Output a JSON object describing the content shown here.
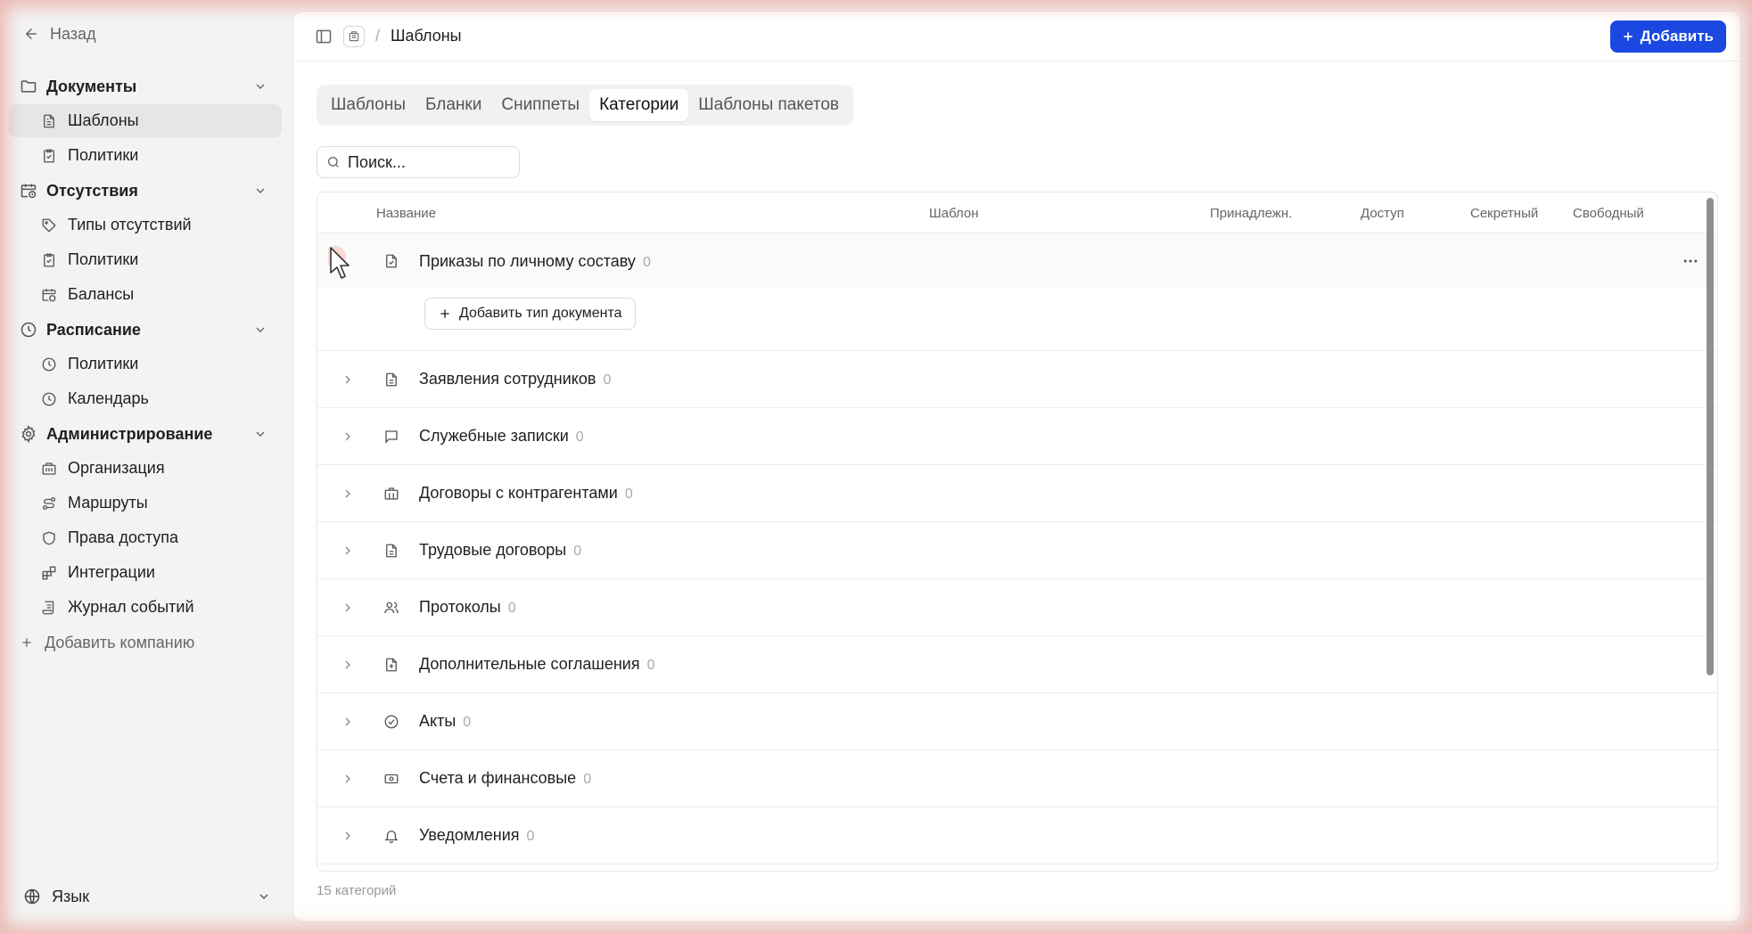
{
  "sidebar": {
    "back_label": "Назад",
    "groups": [
      {
        "label": "Документы",
        "icon": "folder-icon"
      },
      {
        "label": "Отсутствия",
        "icon": "calendar-clock-icon"
      },
      {
        "label": "Расписание",
        "icon": "clock-icon"
      },
      {
        "label": "Администрирование",
        "icon": "gear-icon"
      }
    ],
    "items": [
      {
        "label": "Шаблоны",
        "icon": "file-text-icon"
      },
      {
        "label": "Политики",
        "icon": "clipboard-check-icon"
      },
      {
        "label": "Типы отсутствий",
        "icon": "tag-icon"
      },
      {
        "label": "Политики",
        "icon": "clipboard-check-icon"
      },
      {
        "label": "Балансы",
        "icon": "calendar-clock-icon"
      },
      {
        "label": "Политики",
        "icon": "clock-icon"
      },
      {
        "label": "Календарь",
        "icon": "clock-icon"
      },
      {
        "label": "Организация",
        "icon": "building-icon"
      },
      {
        "label": "Маршруты",
        "icon": "route-icon"
      },
      {
        "label": "Права доступа",
        "icon": "shield-icon"
      },
      {
        "label": "Интеграции",
        "icon": "blocks-icon"
      },
      {
        "label": "Журнал событий",
        "icon": "scroll-icon"
      }
    ],
    "add_company_label": "Добавить компанию",
    "language_label": "Язык"
  },
  "header": {
    "breadcrumb": "Шаблоны",
    "separator": "/",
    "add_button_label": "Добавить"
  },
  "tabs": [
    {
      "label": "Шаблоны"
    },
    {
      "label": "Бланки"
    },
    {
      "label": "Сниппеты"
    },
    {
      "label": "Категории"
    },
    {
      "label": "Шаблоны пакетов"
    }
  ],
  "active_tab": "Категории",
  "search": {
    "placeholder": "Поиск..."
  },
  "table": {
    "columns": [
      "Название",
      "Шаблон",
      "Принадлежн.",
      "Доступ",
      "Секретный",
      "Свободный"
    ],
    "add_type_label": "Добавить тип документа",
    "rows": [
      {
        "name": "Приказы по личному составу",
        "count": "0",
        "icon": "file-check-icon"
      },
      {
        "name": "Заявления сотрудников",
        "count": "0",
        "icon": "file-text-icon"
      },
      {
        "name": "Служебные записки",
        "count": "0",
        "icon": "message-square-icon"
      },
      {
        "name": "Договоры с контрагентами",
        "count": "0",
        "icon": "briefcase-icon"
      },
      {
        "name": "Трудовые договоры",
        "count": "0",
        "icon": "file-text-icon"
      },
      {
        "name": "Протоколы",
        "count": "0",
        "icon": "users-icon"
      },
      {
        "name": "Дополнительные соглашения",
        "count": "0",
        "icon": "file-plus-icon"
      },
      {
        "name": "Акты",
        "count": "0",
        "icon": "circle-check-icon"
      },
      {
        "name": "Счета и финансовые",
        "count": "0",
        "icon": "banknote-icon"
      },
      {
        "name": "Уведомления",
        "count": "0",
        "icon": "bell-icon"
      }
    ]
  },
  "footer": {
    "count_label": "15 категорий"
  },
  "colors": {
    "accent": "#1a48e0",
    "sidebar_bg": "#f3f3f3",
    "active_item_bg": "#e6e6e6"
  }
}
